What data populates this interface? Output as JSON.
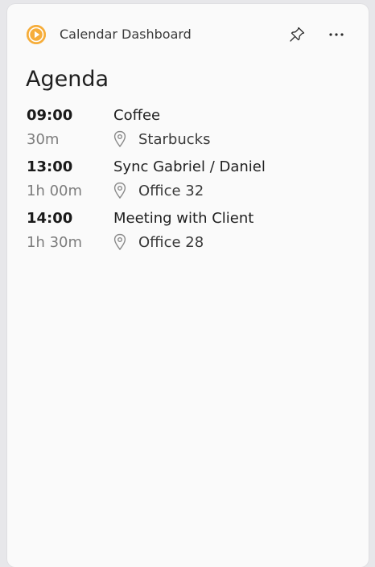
{
  "header": {
    "app_title": "Calendar Dashboard",
    "icons": {
      "app": "play-circle-icon",
      "pin": "pin-icon",
      "more": "more-horizontal-icon"
    },
    "accent_color": "#f6ad3a"
  },
  "agenda": {
    "title": "Agenda",
    "events": [
      {
        "time": "09:00",
        "duration": "30m",
        "title": "Coffee",
        "location": "Starbucks"
      },
      {
        "time": "13:00",
        "duration": "1h 00m",
        "title": "Sync Gabriel / Daniel",
        "location": "Office 32"
      },
      {
        "time": "14:00",
        "duration": "1h 30m",
        "title": "Meeting with Client",
        "location": "Office 28"
      }
    ]
  }
}
